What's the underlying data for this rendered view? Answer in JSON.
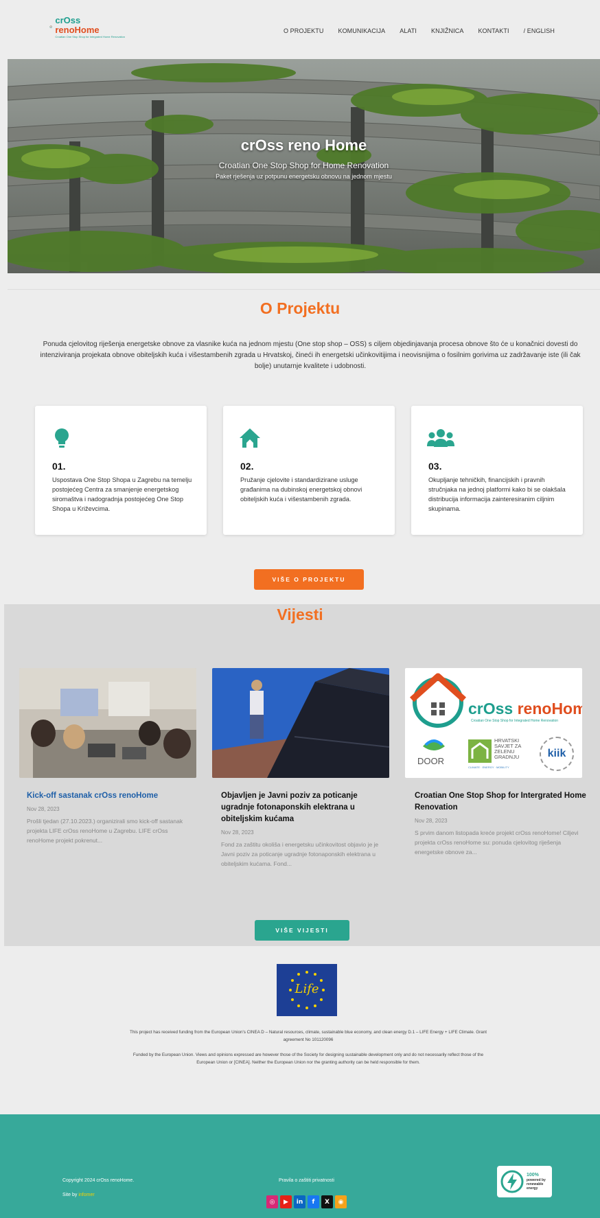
{
  "header": {
    "logo": {
      "name_part1": "crOss",
      "name_part2": "renoHome",
      "tagline": "Croatian One Stop Shop for Integrated Home Renovation"
    },
    "nav": [
      "O PROJEKTU",
      "KOMUNIKACIJA",
      "ALATI",
      "KNJIŽNICA",
      "KONTAKTI",
      "/ ENGLISH"
    ]
  },
  "hero": {
    "title": "crOss reno Home",
    "subtitle": "Croatian One Stop Shop for Home Renovation",
    "subtitle2": "Paket rješenja uz potpunu energetsku obnovu na jednom mjestu"
  },
  "about": {
    "title": "O Projektu",
    "intro": "Ponuda cjelovitog riješenja energetske obnove za vlasnike kuća na jednom mjestu (One stop shop – OSS) s ciljem objedinjavanja procesa obnove što će u konačnici dovesti do intenziviranja projekata obnove obiteljskih kuća i višestambenih zgrada u Hrvatskoj, čineći ih energetski učinkovitijima i neovisnijima o fosilnim gorivima uz zadržavanje iste (ili čak bolje) unutarnje kvalitete i udobnosti.",
    "cards": [
      {
        "number": "01.",
        "icon": "lightbulb-icon",
        "text": "Uspostava One Stop Shopa u Zagrebu na temelju postojećeg Centra za smanjenje energetskog siromaštva i nadogradnja postojećeg One Stop Shopa u Križevcima."
      },
      {
        "number": "02.",
        "icon": "house-icon",
        "text": "Pružanje cjelovite i standardizirane usluge građanima na dubinskoj energetskoj obnovi obiteljskih kuća i višestambenih zgrada."
      },
      {
        "number": "03.",
        "icon": "users-icon",
        "text": "Okupljanje tehničkih, financijskih i pravnih stručnjaka na jednoj platformi kako bi se olakšala distribucija informacija zainteresiranim ciljnim skupinama."
      }
    ],
    "button": "VIŠE O PROJEKTU"
  },
  "news": {
    "title": "Vijesti",
    "items": [
      {
        "title": "Kick-off sastanak crOss renoHome",
        "date": "Nov 28, 2023",
        "excerpt": "Prošli tjedan (27.10.2023.) organizirali smo kick-off sastanak projekta LIFE crOss renoHome u Zagrebu. LIFE crOss renoHome projekt pokrenut..."
      },
      {
        "title": "Objavljen je Javni poziv za poticanje ugradnje fotonaponskih elektrana u obiteljskim kućama",
        "date": "Nov 28, 2023",
        "excerpt": "Fond za zaštitu okoliša i energetsku učinkovitost objavio je je Javni poziv za poticanje ugradnje fotonaponskih elektrana u obiteljskim kućama. Fond..."
      },
      {
        "title": "Croatian One Stop Shop for Intergrated Home Renovation",
        "date": "Nov 28, 2023",
        "excerpt": "S prvim danom listopada kreće projekt crOss renoHome! Ciljevi projekta crOss renoHome su: ponuda cjelovitog riješenja energetske obnove za..."
      }
    ],
    "logo_card": {
      "name_part1": "crOss",
      "name_part2": "renoHome",
      "tagline": "Croatian One Stop Shop for Integrated Home Renovation",
      "door": "DOOR",
      "hsgz": [
        "HRVATSKI",
        "SAVJET ZA",
        "ZELENU",
        "GRADNJU"
      ],
      "hsgz_tag": "CLIMATE · ENERGY · MOBILITY",
      "kiik": "kiik"
    },
    "button": "VIŠE VIJESTI"
  },
  "eu": {
    "life_text": "Life",
    "text1": "This project has received funding from the European Union's CINEA D – Natural resources, climate, sustainable blue economy, and clean energy D.1 – LIFE Energy + LIFE Climate. Grant agreement No 101120096",
    "text2": "Funded by the European Union. Views and opinions expressed are however those of the Society for designing sustainable development only and do not necessarily reflect those of the European Union or [CINEA]. Neither the European Union nor the granting authority can be held responsible for them."
  },
  "footer": {
    "copyright": "Copyright 2024 crOss renoHome.",
    "site_by_label": "Site by",
    "site_by_name": "infomer",
    "privacy": "Pravila o zaštiti privatnosti",
    "socials": [
      {
        "name": "instagram-icon",
        "glyph": "◎",
        "color": "#d62976"
      },
      {
        "name": "youtube-icon",
        "glyph": "▶",
        "color": "#e62117"
      },
      {
        "name": "linkedin-icon",
        "glyph": "in",
        "color": "#0a66c2"
      },
      {
        "name": "facebook-icon",
        "glyph": "f",
        "color": "#1877f2"
      },
      {
        "name": "x-icon",
        "glyph": "X",
        "color": "#111111"
      },
      {
        "name": "rss-icon",
        "glyph": "◉",
        "color": "#f5a21b"
      }
    ],
    "badge": {
      "pct": "100%",
      "line1": "powered by",
      "line2": "renewable",
      "line3": "energy"
    }
  },
  "colors": {
    "orange": "#f26f21",
    "teal": "#2aa58f",
    "footer": "#37a99a",
    "link_blue": "#1e5fa8"
  }
}
